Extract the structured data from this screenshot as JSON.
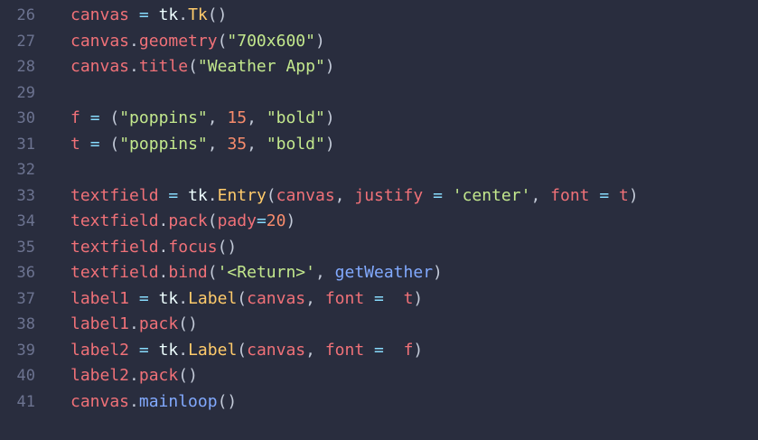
{
  "editor": {
    "lines": [
      {
        "num": "26",
        "tokens": [
          {
            "t": "canvas",
            "c": "var"
          },
          {
            "t": " ",
            "c": "plain"
          },
          {
            "t": "=",
            "c": "op"
          },
          {
            "t": " ",
            "c": "plain"
          },
          {
            "t": "tk",
            "c": "plain"
          },
          {
            "t": ".",
            "c": "punc"
          },
          {
            "t": "Tk",
            "c": "mod"
          },
          {
            "t": "()",
            "c": "punc"
          }
        ]
      },
      {
        "num": "27",
        "tokens": [
          {
            "t": "canvas",
            "c": "var"
          },
          {
            "t": ".",
            "c": "punc"
          },
          {
            "t": "geometry",
            "c": "var"
          },
          {
            "t": "(",
            "c": "punc"
          },
          {
            "t": "\"700x600\"",
            "c": "str"
          },
          {
            "t": ")",
            "c": "punc"
          }
        ]
      },
      {
        "num": "28",
        "tokens": [
          {
            "t": "canvas",
            "c": "var"
          },
          {
            "t": ".",
            "c": "punc"
          },
          {
            "t": "title",
            "c": "var"
          },
          {
            "t": "(",
            "c": "punc"
          },
          {
            "t": "\"Weather App\"",
            "c": "str"
          },
          {
            "t": ")",
            "c": "punc"
          }
        ]
      },
      {
        "num": "29",
        "tokens": []
      },
      {
        "num": "30",
        "tokens": [
          {
            "t": "f",
            "c": "var"
          },
          {
            "t": " ",
            "c": "plain"
          },
          {
            "t": "=",
            "c": "op"
          },
          {
            "t": " ",
            "c": "plain"
          },
          {
            "t": "(",
            "c": "punc"
          },
          {
            "t": "\"poppins\"",
            "c": "str"
          },
          {
            "t": ", ",
            "c": "punc"
          },
          {
            "t": "15",
            "c": "num"
          },
          {
            "t": ", ",
            "c": "punc"
          },
          {
            "t": "\"bold\"",
            "c": "str"
          },
          {
            "t": ")",
            "c": "punc"
          }
        ]
      },
      {
        "num": "31",
        "tokens": [
          {
            "t": "t",
            "c": "var"
          },
          {
            "t": " ",
            "c": "plain"
          },
          {
            "t": "=",
            "c": "op"
          },
          {
            "t": " ",
            "c": "plain"
          },
          {
            "t": "(",
            "c": "punc"
          },
          {
            "t": "\"poppins\"",
            "c": "str"
          },
          {
            "t": ", ",
            "c": "punc"
          },
          {
            "t": "35",
            "c": "num"
          },
          {
            "t": ", ",
            "c": "punc"
          },
          {
            "t": "\"bold\"",
            "c": "str"
          },
          {
            "t": ")",
            "c": "punc"
          }
        ]
      },
      {
        "num": "32",
        "tokens": []
      },
      {
        "num": "33",
        "tokens": [
          {
            "t": "textfield",
            "c": "var"
          },
          {
            "t": " ",
            "c": "plain"
          },
          {
            "t": "=",
            "c": "op"
          },
          {
            "t": " ",
            "c": "plain"
          },
          {
            "t": "tk",
            "c": "plain"
          },
          {
            "t": ".",
            "c": "punc"
          },
          {
            "t": "Entry",
            "c": "mod"
          },
          {
            "t": "(",
            "c": "punc"
          },
          {
            "t": "canvas",
            "c": "var"
          },
          {
            "t": ", ",
            "c": "punc"
          },
          {
            "t": "justify",
            "c": "param"
          },
          {
            "t": " ",
            "c": "plain"
          },
          {
            "t": "=",
            "c": "op"
          },
          {
            "t": " ",
            "c": "plain"
          },
          {
            "t": "'center'",
            "c": "str"
          },
          {
            "t": ", ",
            "c": "punc"
          },
          {
            "t": "font",
            "c": "param"
          },
          {
            "t": " ",
            "c": "plain"
          },
          {
            "t": "=",
            "c": "op"
          },
          {
            "t": " ",
            "c": "plain"
          },
          {
            "t": "t",
            "c": "var"
          },
          {
            "t": ")",
            "c": "punc"
          }
        ]
      },
      {
        "num": "34",
        "tokens": [
          {
            "t": "textfield",
            "c": "var"
          },
          {
            "t": ".",
            "c": "punc"
          },
          {
            "t": "pack",
            "c": "var"
          },
          {
            "t": "(",
            "c": "punc"
          },
          {
            "t": "pady",
            "c": "param"
          },
          {
            "t": "=",
            "c": "op"
          },
          {
            "t": "20",
            "c": "num"
          },
          {
            "t": ")",
            "c": "punc"
          }
        ]
      },
      {
        "num": "35",
        "tokens": [
          {
            "t": "textfield",
            "c": "var"
          },
          {
            "t": ".",
            "c": "punc"
          },
          {
            "t": "focus",
            "c": "var"
          },
          {
            "t": "()",
            "c": "punc"
          }
        ]
      },
      {
        "num": "36",
        "tokens": [
          {
            "t": "textfield",
            "c": "var"
          },
          {
            "t": ".",
            "c": "punc"
          },
          {
            "t": "bind",
            "c": "var"
          },
          {
            "t": "(",
            "c": "punc"
          },
          {
            "t": "'<Return>'",
            "c": "str"
          },
          {
            "t": ", ",
            "c": "punc"
          },
          {
            "t": "getWeather",
            "c": "fn"
          },
          {
            "t": ")",
            "c": "punc"
          }
        ]
      },
      {
        "num": "37",
        "tokens": [
          {
            "t": "label1",
            "c": "var"
          },
          {
            "t": " ",
            "c": "plain"
          },
          {
            "t": "=",
            "c": "op"
          },
          {
            "t": " ",
            "c": "plain"
          },
          {
            "t": "tk",
            "c": "plain"
          },
          {
            "t": ".",
            "c": "punc"
          },
          {
            "t": "Label",
            "c": "mod"
          },
          {
            "t": "(",
            "c": "punc"
          },
          {
            "t": "canvas",
            "c": "var"
          },
          {
            "t": ", ",
            "c": "punc"
          },
          {
            "t": "font",
            "c": "param"
          },
          {
            "t": " ",
            "c": "plain"
          },
          {
            "t": "=",
            "c": "op"
          },
          {
            "t": "  ",
            "c": "plain"
          },
          {
            "t": "t",
            "c": "var"
          },
          {
            "t": ")",
            "c": "punc"
          }
        ]
      },
      {
        "num": "38",
        "tokens": [
          {
            "t": "label1",
            "c": "var"
          },
          {
            "t": ".",
            "c": "punc"
          },
          {
            "t": "pack",
            "c": "var"
          },
          {
            "t": "()",
            "c": "punc"
          }
        ]
      },
      {
        "num": "39",
        "tokens": [
          {
            "t": "label2",
            "c": "var"
          },
          {
            "t": " ",
            "c": "plain"
          },
          {
            "t": "=",
            "c": "op"
          },
          {
            "t": " ",
            "c": "plain"
          },
          {
            "t": "tk",
            "c": "plain"
          },
          {
            "t": ".",
            "c": "punc"
          },
          {
            "t": "Label",
            "c": "mod"
          },
          {
            "t": "(",
            "c": "punc"
          },
          {
            "t": "canvas",
            "c": "var"
          },
          {
            "t": ", ",
            "c": "punc"
          },
          {
            "t": "font",
            "c": "param"
          },
          {
            "t": " ",
            "c": "plain"
          },
          {
            "t": "=",
            "c": "op"
          },
          {
            "t": "  ",
            "c": "plain"
          },
          {
            "t": "f",
            "c": "var"
          },
          {
            "t": ")",
            "c": "punc"
          }
        ]
      },
      {
        "num": "40",
        "tokens": [
          {
            "t": "label2",
            "c": "var"
          },
          {
            "t": ".",
            "c": "punc"
          },
          {
            "t": "pack",
            "c": "var"
          },
          {
            "t": "()",
            "c": "punc"
          }
        ]
      },
      {
        "num": "41",
        "tokens": [
          {
            "t": "canvas",
            "c": "var"
          },
          {
            "t": ".",
            "c": "punc"
          },
          {
            "t": "mainloop",
            "c": "fn"
          },
          {
            "t": "()",
            "c": "punc"
          }
        ]
      }
    ]
  },
  "theme": {
    "background": "#292d3e",
    "line_number": "#6c7390",
    "variable": "#f07178",
    "string": "#c3e88d",
    "number": "#f78c6c",
    "function": "#82aaff",
    "class": "#ffcb6b",
    "operator": "#89ddff"
  }
}
